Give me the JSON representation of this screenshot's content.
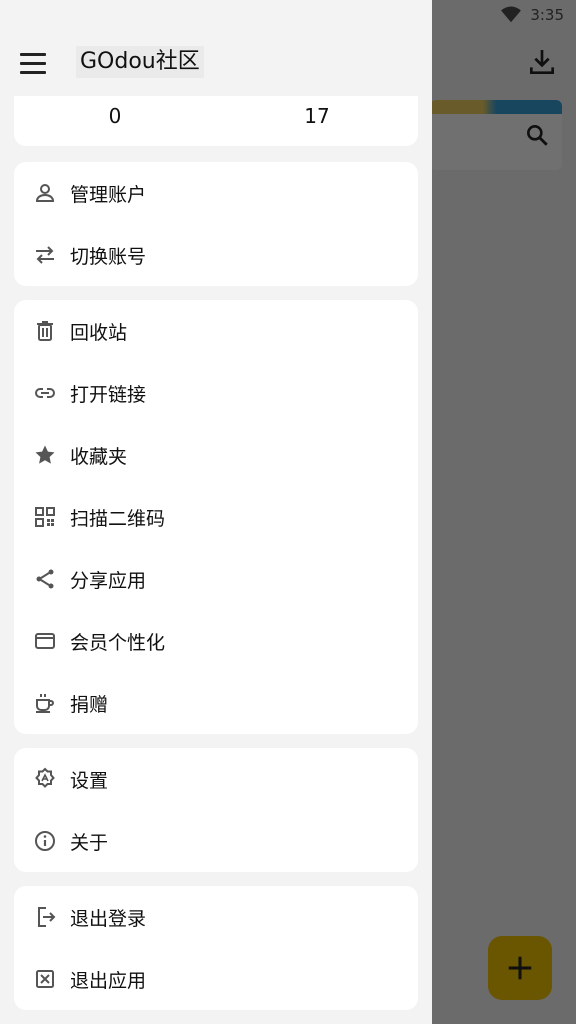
{
  "status_bar": {
    "time": "3:35"
  },
  "drawer": {
    "title": "GOdou社区",
    "stats": [
      "0",
      "17"
    ]
  },
  "groups": [
    {
      "items": [
        {
          "label": "管理账户",
          "icon": "person-icon"
        },
        {
          "label": "切换账号",
          "icon": "swap-icon"
        }
      ]
    },
    {
      "items": [
        {
          "label": "回收站",
          "icon": "trash-icon"
        },
        {
          "label": "打开链接",
          "icon": "link-icon"
        },
        {
          "label": "收藏夹",
          "icon": "star-icon"
        },
        {
          "label": "扫描二维码",
          "icon": "qr-code-icon"
        },
        {
          "label": "分享应用",
          "icon": "share-icon"
        },
        {
          "label": "会员个性化",
          "icon": "wallet-icon"
        },
        {
          "label": "捐赠",
          "icon": "coffee-icon"
        }
      ]
    },
    {
      "items": [
        {
          "label": "设置",
          "icon": "settings-icon"
        },
        {
          "label": "关于",
          "icon": "info-icon"
        }
      ]
    },
    {
      "items": [
        {
          "label": "退出登录",
          "icon": "logout-icon"
        },
        {
          "label": "退出应用",
          "icon": "close-box-icon"
        }
      ]
    }
  ],
  "colors": {
    "accent": "#f2c200",
    "drawer_bg": "#f3f3f3",
    "card_bg": "#ffffff",
    "scrim": "#6e6e6e"
  }
}
